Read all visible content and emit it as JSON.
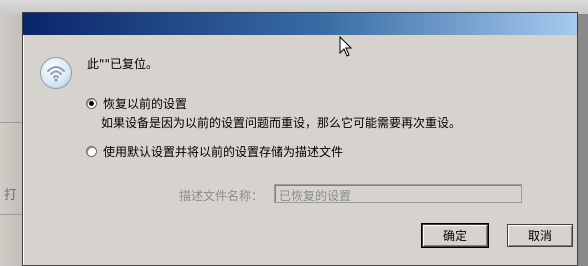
{
  "dialog": {
    "message": "此\"\"已复位。",
    "options": [
      {
        "label": "恢复以前的设置",
        "selected": true
      },
      {
        "label": "使用默认设置并将以前的设置存储为描述文件",
        "selected": false
      }
    ],
    "option1_description": "如果设备是因为以前的设置问题而重设，那么它可能需要再次重设。",
    "field": {
      "label": "描述文件名称：",
      "value": "已恢复的设置"
    },
    "buttons": {
      "ok": "确定",
      "cancel": "取消"
    }
  },
  "background": {
    "partial_text": "打"
  },
  "icons": {
    "status": "wifi-icon",
    "cursor": "mouse-pointer-icon"
  },
  "colors": {
    "titlebar_start": "#0a246a",
    "titlebar_end": "#a6caf0",
    "dialog_bg": "#d6d3ce"
  }
}
